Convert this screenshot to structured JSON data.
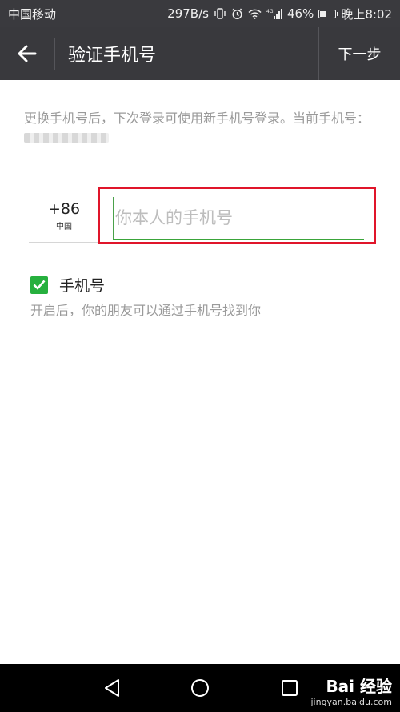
{
  "status_bar": {
    "carrier": "中国移动",
    "speed": "297B/s",
    "network": "4G",
    "battery_percent": "46%",
    "battery_level": 0.46,
    "time": "晚上8:02"
  },
  "app_bar": {
    "title": "验证手机号",
    "next_label": "下一步",
    "back_icon": "arrow-left-icon"
  },
  "description": {
    "line": "更换手机号后，下次登录可使用新手机号登录。当前手机号："
  },
  "country": {
    "code": "+86",
    "name": "中国"
  },
  "phone_input": {
    "placeholder": "你本人的手机号",
    "value": ""
  },
  "discover_option": {
    "label": "手机号",
    "checked": true,
    "hint": "开启后，你的朋友可以通过手机号找到你"
  },
  "watermark": {
    "brand": "Bai 经验",
    "url": "jingyan.baidu.com"
  },
  "colors": {
    "accent_green": "#26b03e",
    "highlight_red": "#e0152a",
    "bar_dark": "#39393d"
  }
}
